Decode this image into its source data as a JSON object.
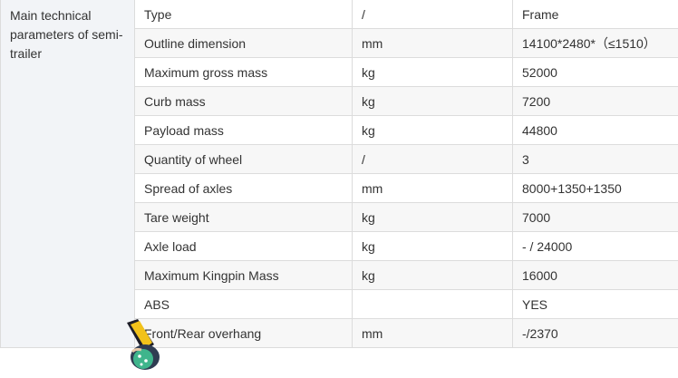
{
  "table": {
    "group_label": "Main technical parameters of semi-trailer",
    "rows": [
      {
        "param": "Type",
        "unit": "/",
        "value": "Frame"
      },
      {
        "param": "Outline dimension",
        "unit": "mm",
        "value": "14100*2480*（≤1510）"
      },
      {
        "param": "Maximum gross mass",
        "unit": "kg",
        "value": "52000"
      },
      {
        "param": "Curb mass",
        "unit": "kg",
        "value": "7200"
      },
      {
        "param": "Payload mass",
        "unit": "kg",
        "value": "44800"
      },
      {
        "param": "Quantity of wheel",
        "unit": "/",
        "value": "3"
      },
      {
        "param": "Spread of axles",
        "unit": "mm",
        "value": "8000+1350+1350"
      },
      {
        "param": "Tare weight",
        "unit": "kg",
        "value": "7000"
      },
      {
        "param": "Axle load",
        "unit": "kg",
        "value": "- / 24000"
      },
      {
        "param": "Maximum Kingpin Mass",
        "unit": "kg",
        "value": "16000"
      },
      {
        "param": "ABS",
        "unit": "",
        "value": "YES"
      },
      {
        "param": "Front/Rear overhang",
        "unit": "mm",
        "value": "-/2370"
      }
    ]
  },
  "overlay": {
    "icon": "cartoon-mascot-sticker-icon"
  }
}
